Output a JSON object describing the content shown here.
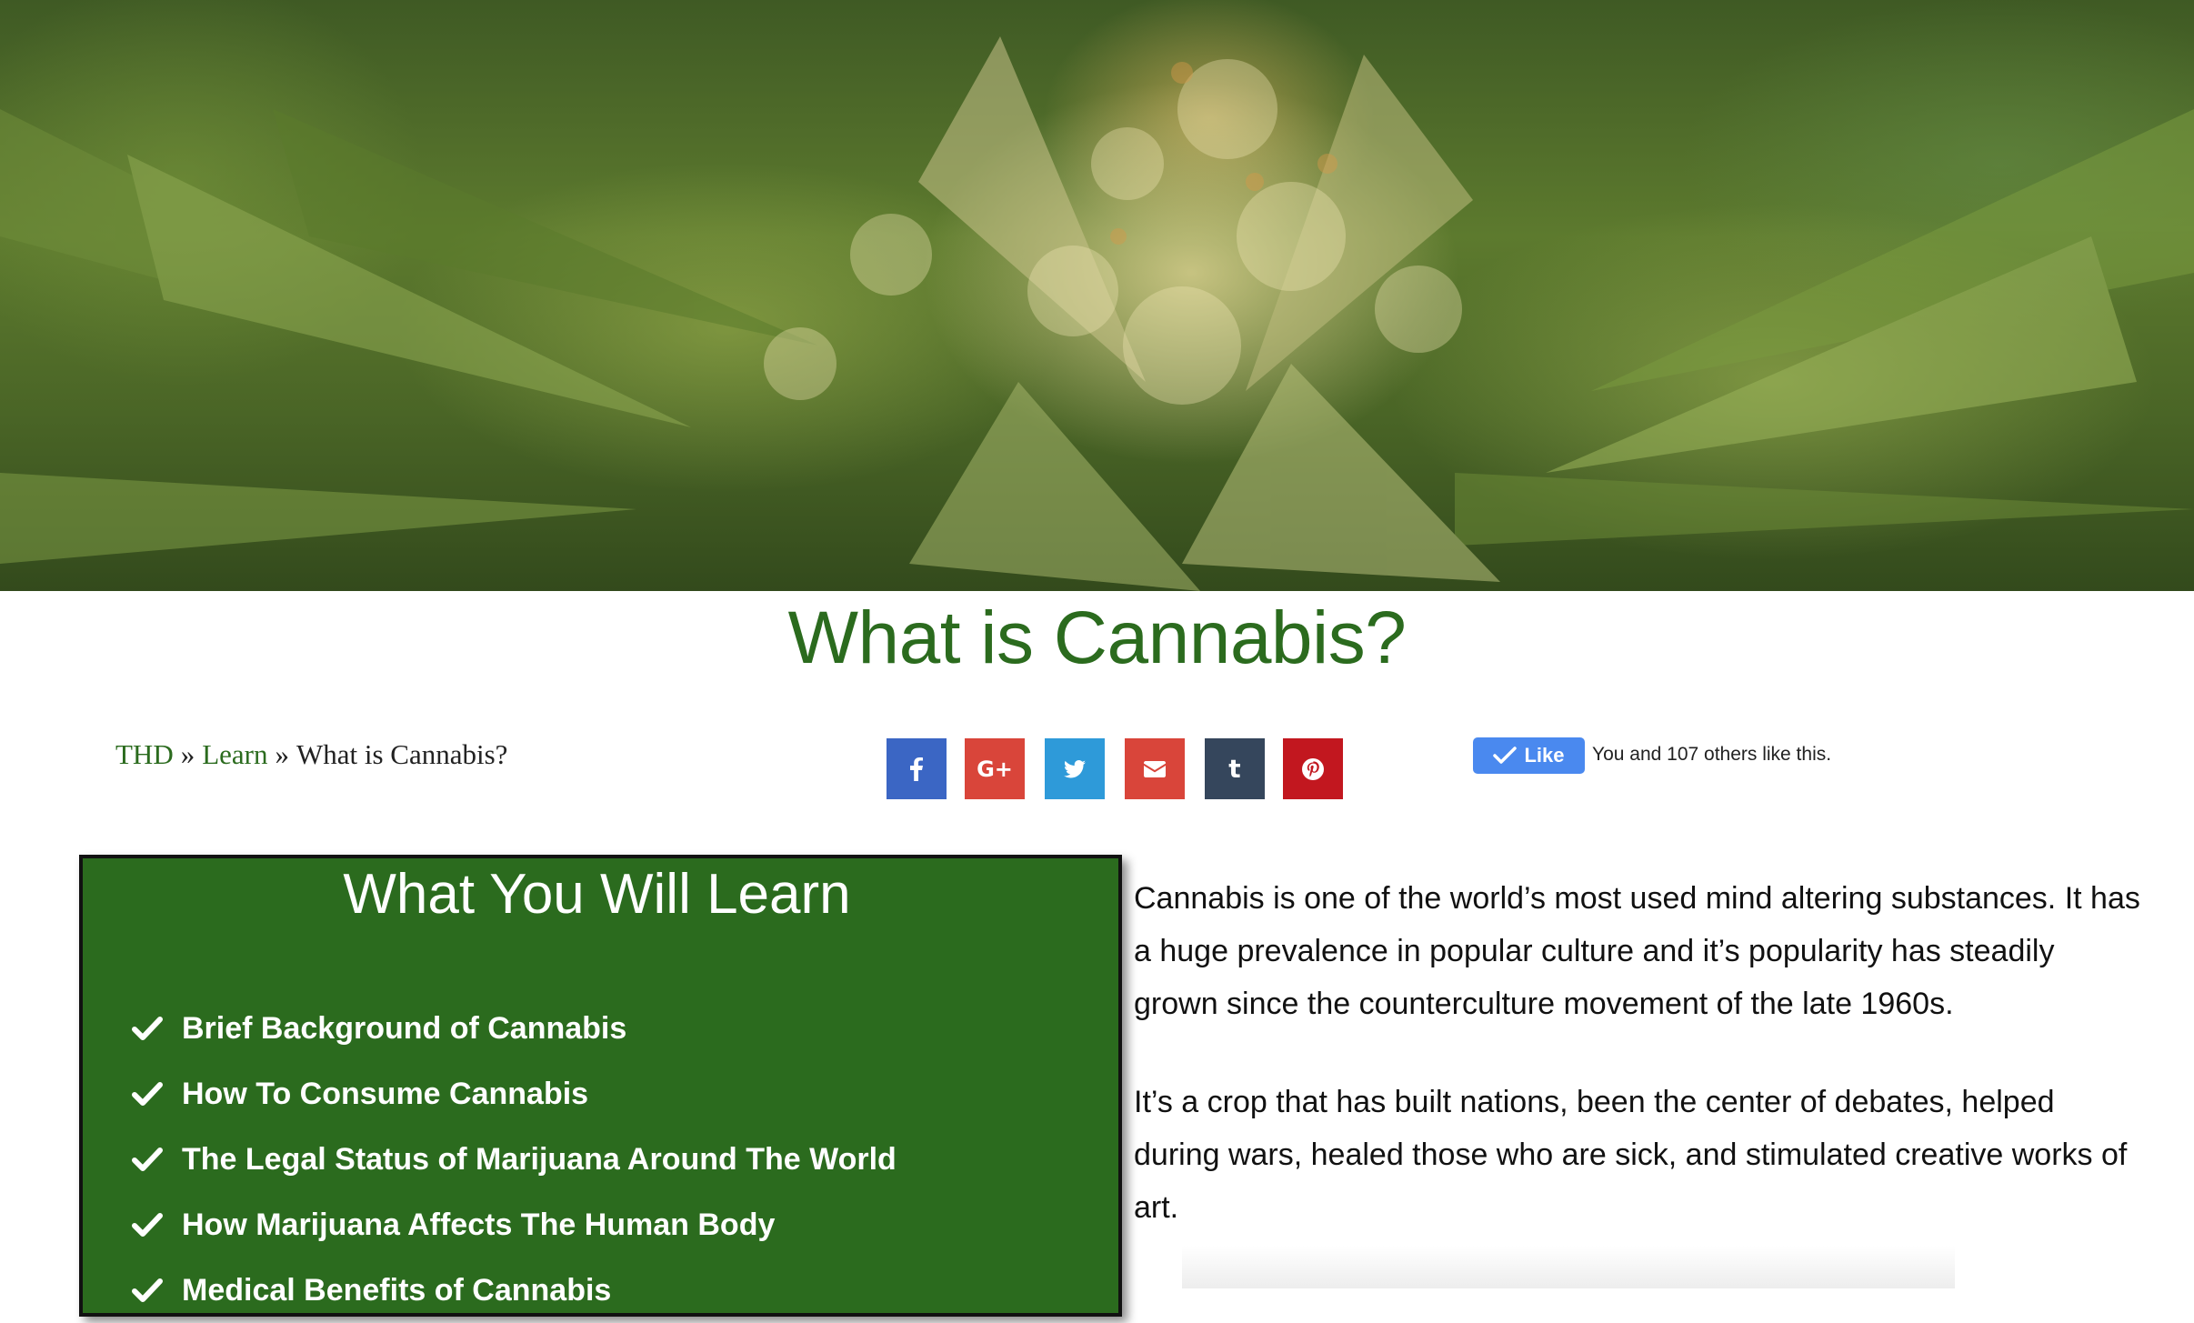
{
  "hero": {
    "image": "cannabis-bud-photo"
  },
  "page": {
    "title": "What is Cannabis?"
  },
  "breadcrumb": {
    "home": "THD",
    "sep1": "»",
    "learn": "Learn",
    "sep2": "»",
    "current": "What is Cannabis?"
  },
  "share": {
    "facebook": "f",
    "google_plus": "G+",
    "twitter": "twitter",
    "email": "email",
    "tumblr": "t",
    "pinterest": "pinterest"
  },
  "like": {
    "button_label": "Like",
    "count_text": "You and 107 others like this."
  },
  "learn_box": {
    "title": "What You Will Learn",
    "items": [
      "Brief Background of Cannabis",
      "How To Consume Cannabis",
      "The Legal Status of Marijuana Around The World",
      "How Marijuana Affects The Human Body",
      "Medical Benefits of Cannabis"
    ]
  },
  "content": {
    "paragraph_1": "Cannabis is one of the world’s most used mind altering substances. It has a huge prevalence in popular culture and it’s popularity has steadily grown since the counterculture movement of the late 1960s.",
    "paragraph_2": "It’s a crop that has built nations, been the center of debates, helped during wars, healed those who are sick, and stimulated creative works of art."
  },
  "colors": {
    "brand_green": "#2b6b1e",
    "facebook": "#3b66c4",
    "google_plus": "#d9453a",
    "twitter": "#2e9ad9",
    "email": "#d9453a",
    "tumblr": "#35465c",
    "pinterest": "#c2171f",
    "like_blue": "#4a89ef"
  }
}
